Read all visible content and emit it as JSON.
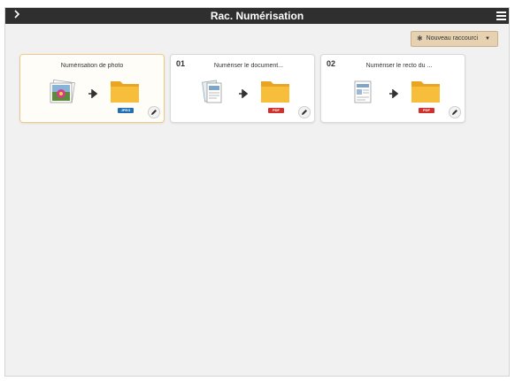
{
  "app": {
    "title": "Rac. Numérisation"
  },
  "toolbar": {
    "new_shortcut_label": "Nouveau raccourci"
  },
  "colors": {
    "titlebar": "#2f2f2f",
    "background": "#f1f1f1",
    "button": "#e6d1b1",
    "folder": "#f5b731",
    "jpeg_badge": "#1f6fb2",
    "pdf_badge": "#d0312d"
  },
  "shortcuts": [
    {
      "number": "",
      "label": "Numérisation de photo",
      "source_icon": "photo-icon",
      "destination_icon": "folder-icon",
      "badge": "JPEG",
      "badge_color": "#1f6fb2",
      "selected": true
    },
    {
      "number": "01",
      "label": "Numériser le document...",
      "source_icon": "document-icon",
      "destination_icon": "folder-icon",
      "badge": "PDF",
      "badge_color": "#d0312d",
      "selected": false
    },
    {
      "number": "02",
      "label": "Numériser le recto du ...",
      "source_icon": "id-card-icon",
      "destination_icon": "folder-icon",
      "badge": "PDF",
      "badge_color": "#d0312d",
      "selected": false
    }
  ]
}
